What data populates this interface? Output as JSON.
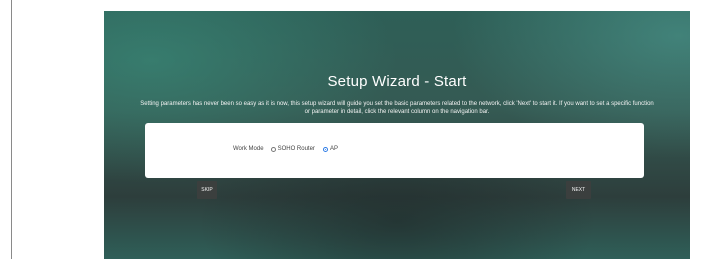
{
  "wizard": {
    "title": "Setup Wizard - Start",
    "intro": "Setting parameters has never been so easy as it is now, this setup wizard will guide you set the basic parameters related to the network, click 'Next' to start it. If you want to set a specific function or parameter in detail, click the relevant column on the navigation bar.",
    "work_mode_label": "Work Mode",
    "options": [
      {
        "label": "SOHO Router",
        "selected": false
      },
      {
        "label": "AP",
        "selected": true
      }
    ],
    "skip_label": "SKIP",
    "next_label": "NEXT"
  }
}
